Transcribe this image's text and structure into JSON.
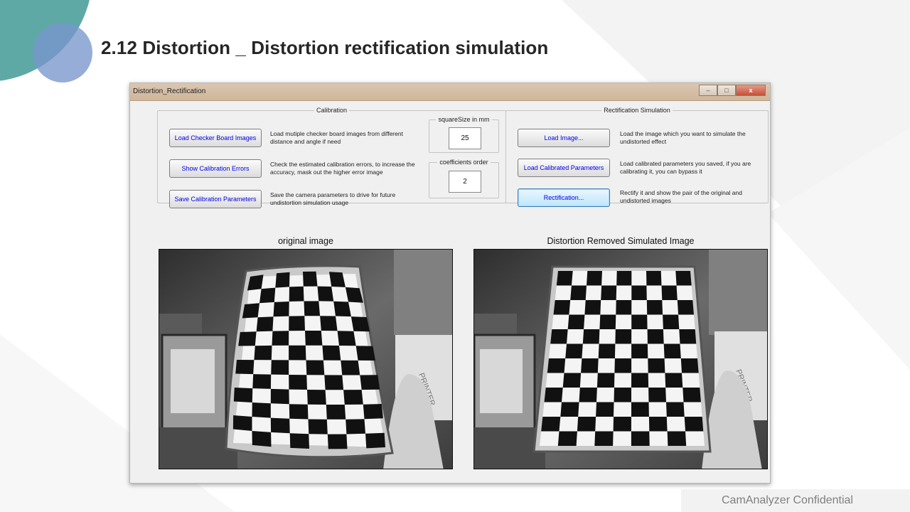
{
  "slide": {
    "title": "2.12  Distortion _ Distortion rectification simulation",
    "footer": "CamAnalyzer  Confidential"
  },
  "window": {
    "title": "Distortion_Rectification",
    "controls": {
      "minimize": "–",
      "maximize": "□",
      "close": "x"
    }
  },
  "calibration": {
    "legend": "Calibration",
    "buttons": [
      {
        "label": "Load Checker Board Images",
        "description": "Load mutiple checker board images from different distance and angle if need"
      },
      {
        "label": "Show Calibration Errors",
        "description": "Check the estimated calibration errors, to increase the accuracy, mask out the higher error image"
      },
      {
        "label": "Save Calibration Parameters",
        "description": "Save the camera parameters to drive for future undistortion simulation usage"
      }
    ],
    "square_size": {
      "legend": "squareSize in mm",
      "value": "25"
    },
    "coefficients_order": {
      "legend": "coefficients order",
      "value": "2"
    }
  },
  "rectification": {
    "legend": "Rectification Simulation",
    "buttons": [
      {
        "label": "Load Image...",
        "description": "Load the image which you want to simulate the undistorted effect"
      },
      {
        "label": "Load Calibrated Parameters",
        "description": "Load calibrated parameters you saved, if you are calibrating it, you can bypass it"
      },
      {
        "label": "Rectification...",
        "description": "Rectify it and show the pair of the original and undistorted images"
      }
    ]
  },
  "images": {
    "original_caption": "original image",
    "undistorted_caption": "Distortion Removed Simulated Image",
    "whiteboard_text": "PRINTER"
  },
  "colors": {
    "accent_teal": "#5ea9a5",
    "accent_blue": "#7896cd",
    "button_text": "#0000e6"
  }
}
